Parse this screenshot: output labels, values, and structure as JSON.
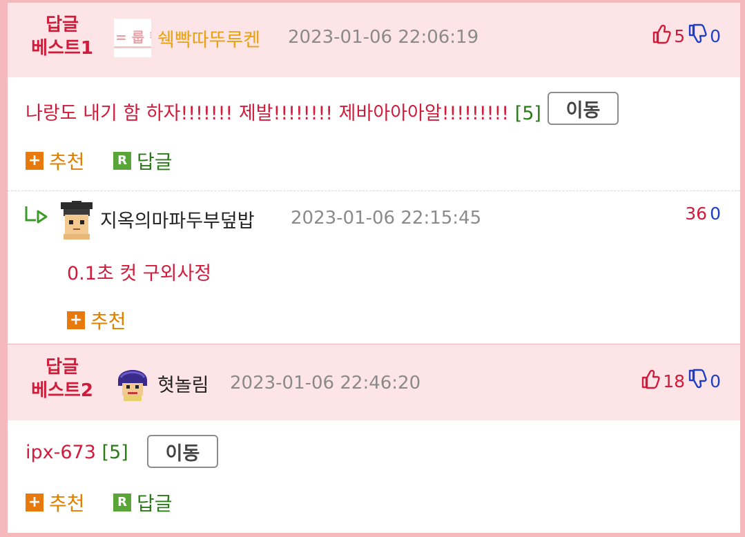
{
  "best1": {
    "label_line1": "답글",
    "label_line2": "베스트1",
    "nickname": "쉑빡따뚜루켄",
    "timestamp": "2023-01-06 22:06:19",
    "up_count": "5",
    "down_count": "0",
    "comment_text": "나랑도 내기 함 하자!!!!!!! 제발!!!!!!!! 제바아아아알!!!!!!!!!",
    "reply_count": "[5]",
    "move_label": "이동",
    "recommend_label": "추천",
    "reply_label": "답글"
  },
  "reply1": {
    "nickname": "지옥의마파두부덮밥",
    "timestamp": "2023-01-06 22:15:45",
    "up_count": "36",
    "down_count": "0",
    "comment_text": "0.1초 컷 구외사정",
    "recommend_label": "추천"
  },
  "best2": {
    "label_line1": "답글",
    "label_line2": "베스트2",
    "nickname": "혓놀림",
    "timestamp": "2023-01-06 22:46:20",
    "up_count": "18",
    "down_count": "0",
    "comment_text": "ipx-673",
    "reply_count": "[5]",
    "move_label": "이동",
    "recommend_label": "추천",
    "reply_label": "답글"
  },
  "colors": {
    "accent_red": "#d21b3b",
    "header_bg": "#fde4e6",
    "border_pink": "#f5b8bc",
    "down_blue": "#1d3fc6",
    "reply_green": "#2a7a1a",
    "recommend_orange": "#e07f00"
  },
  "icons": {
    "thumbs_up": "thumbs-up-icon",
    "thumbs_down": "thumbs-down-icon",
    "plus": "plus-icon",
    "reply_r": "reply-r-icon",
    "reply_arrow": "reply-arrow-icon"
  }
}
